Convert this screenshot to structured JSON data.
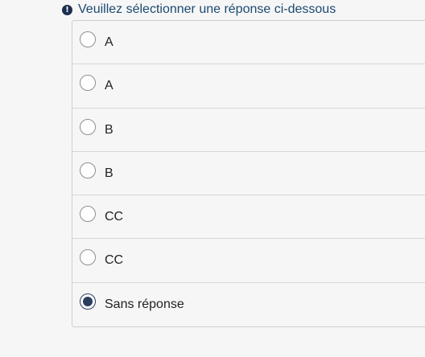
{
  "tip": {
    "icon": "exclamation-circle-icon",
    "text": "Veuillez sélectionner une réponse ci-dessous"
  },
  "answers": [
    {
      "label": "A",
      "selected": false
    },
    {
      "label": "A",
      "selected": false
    },
    {
      "label": "B",
      "selected": false
    },
    {
      "label": "B",
      "selected": false
    },
    {
      "label": "CC",
      "selected": false
    },
    {
      "label": "CC",
      "selected": false
    },
    {
      "label": "Sans réponse",
      "selected": true
    }
  ],
  "colors": {
    "accent": "#2c3e5e",
    "tip_text": "#1a4a6f",
    "background": "#f7f6f7"
  }
}
